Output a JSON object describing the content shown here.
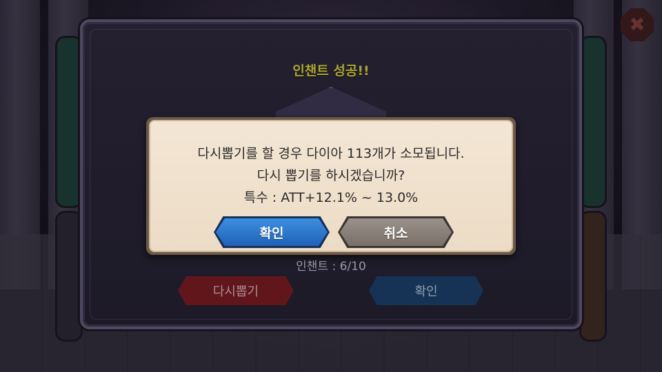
{
  "popup": {
    "title": "인챈트 성공!!",
    "enchant_count": "인챈트 : 6/10",
    "reroll_button": "다시뽑기",
    "confirm_button": "확인"
  },
  "dialog": {
    "line1": "다시뽑기를 할 경우 다이아 113개가 소모됩니다.",
    "line2": "다시 뽑기를 하시겠습니까?",
    "line3": "특수 : ATT+12.1% ~ 13.0%",
    "ok_button": "확인",
    "cancel_button": "취소"
  },
  "icons": {
    "close": "close-icon"
  },
  "colors": {
    "title": "#c9c53a",
    "ok_button": "#1f62b8",
    "cancel_button": "#7a706a",
    "reroll_button": "#731b22"
  }
}
